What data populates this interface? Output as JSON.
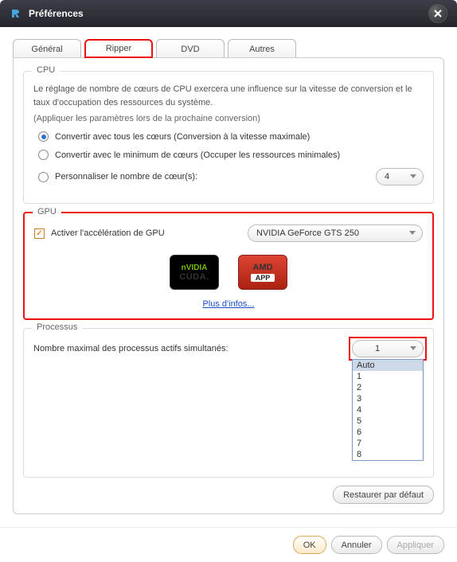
{
  "window": {
    "title": "Préférences"
  },
  "tabs": {
    "general": "Général",
    "ripper": "Ripper",
    "dvd": "DVD",
    "autres": "Autres"
  },
  "cpu": {
    "title": "CPU",
    "desc": "Le réglage de nombre de cœurs de CPU exercera une influence sur la vitesse de conversion et le taux d'occupation des ressources du système.",
    "note": "(Appliquer les paramètres lors de la prochaine conversion)",
    "opt1": "Convertir avec tous les cœurs (Conversion à la vitesse maximale)",
    "opt2": "Convertir avec le minimum de cœurs (Occuper les ressources minimales)",
    "opt3": "Personnaliser le nombre de cœur(s):",
    "cores_value": "4"
  },
  "gpu": {
    "title": "GPU",
    "enable": "Activer l'accélération de GPU",
    "device": "NVIDIA GeForce GTS 250",
    "nvidia_top": "nVIDIA",
    "nvidia_bot": "CUDA.",
    "amd_top": "AMD",
    "amd_bot": "APP",
    "link": "Plus d'infos..."
  },
  "proc": {
    "title": "Processus",
    "label": "Nombre maximal des processus actifs simultanés:",
    "value": "1",
    "options": [
      "Auto",
      "1",
      "2",
      "3",
      "4",
      "5",
      "6",
      "7",
      "8"
    ]
  },
  "buttons": {
    "restore": "Restaurer par défaut",
    "ok": "OK",
    "cancel": "Annuler",
    "apply": "Appliquer"
  }
}
